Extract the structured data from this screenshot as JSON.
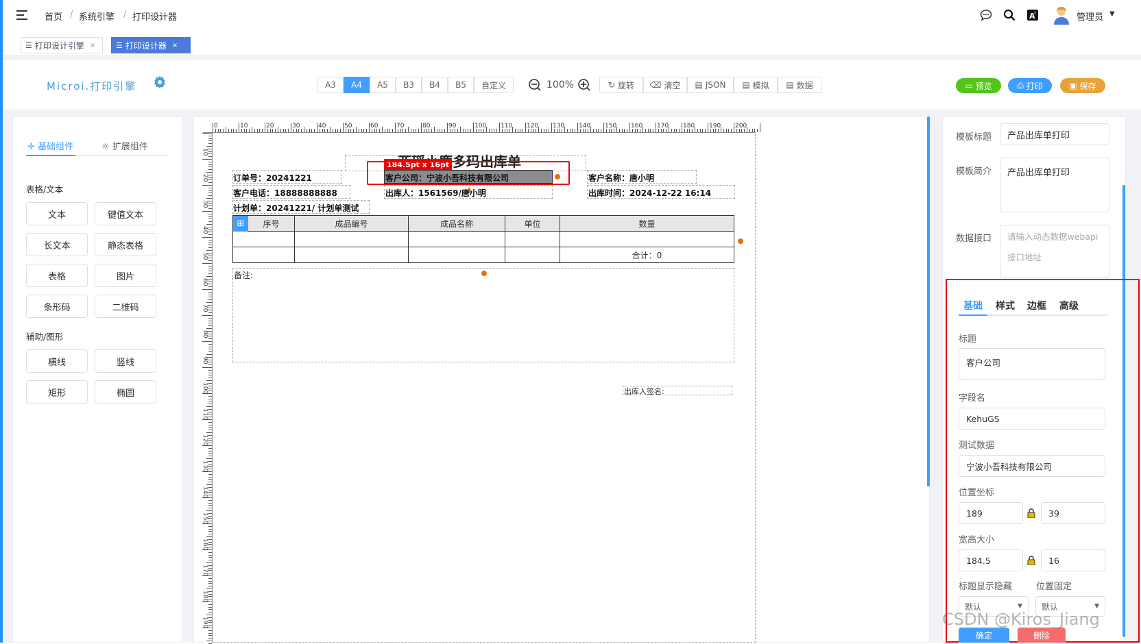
{
  "header": {
    "breadcrumb": [
      "首页",
      "系统引擎",
      "打印设计器"
    ],
    "user": "管理员"
  },
  "tabs": [
    {
      "label": "打印设计引擎",
      "active": false
    },
    {
      "label": "打印设计器",
      "active": true
    }
  ],
  "toolbar": {
    "logo": "Microi.打印引擎",
    "paper_sizes": [
      "A3",
      "A4",
      "A5",
      "B3",
      "B4",
      "B5",
      "自定义"
    ],
    "active_paper": "A4",
    "zoom": "100%",
    "actions": [
      "旋转",
      "清空",
      "JSON",
      "模拟",
      "数据"
    ],
    "preview": "预览",
    "print": "打印",
    "save": "保存"
  },
  "left_panel": {
    "tabs": [
      "基础组件",
      "扩展组件"
    ],
    "section1": "表格/文本",
    "section1_items": [
      "文本",
      "键值文本",
      "长文本",
      "静态表格",
      "表格",
      "图片",
      "条形码",
      "二维码"
    ],
    "section2": "辅助/图形",
    "section2_items": [
      "横线",
      "竖线",
      "矩形",
      "椭圆"
    ]
  },
  "canvas": {
    "ruler_top": [
      "0",
      "10",
      "20",
      "30",
      "40",
      "50",
      "60",
      "70",
      "80",
      "90",
      "100",
      "110",
      "120",
      "130",
      "140",
      "150",
      "160",
      "170",
      "180",
      "190",
      "200"
    ],
    "ruler_left": [
      "10",
      "20",
      "30",
      "40",
      "50",
      "60",
      "70",
      "80",
      "90",
      "100",
      "110",
      "120",
      "130",
      "140",
      "150",
      "160",
      "170",
      "180",
      "190"
    ],
    "title": "亚瑶小鹿多玛出库单",
    "size_badge": "184.5pt x 16pt",
    "order_no": "订单号：20241221",
    "customer_company": "客户公司：宁波小吾科技有限公司",
    "customer_name": "客户名称：唐小明",
    "customer_phone": "客户电话：18888888888",
    "outbound_person": "出库人：1561569/唐小明",
    "outbound_time": "出库时间：2024-12-22 16:14",
    "plan": "计划单：20241221/ 计划单测试",
    "table_headers": [
      "序号",
      "成品编号",
      "成品名称",
      "单位",
      "数量"
    ],
    "total": "合计：0",
    "remark": "备注:",
    "signature": "出库人签名:"
  },
  "right_panel": {
    "template_title_label": "模板标题",
    "template_title_value": "产品出库单打印",
    "template_desc_label": "模板简介",
    "template_desc_value": "产品出库单打印",
    "data_api_label": "数据接口",
    "data_api_placeholder": "请输入动态数据webapi接口地址",
    "prop_tabs": [
      "基础",
      "样式",
      "边框",
      "高级"
    ],
    "title_label": "标题",
    "title_value": "客户公司",
    "field_label": "字段名",
    "field_value": "KehuGS",
    "test_label": "测试数据",
    "test_value": "宁波小吾科技有限公司",
    "pos_label": "位置坐标",
    "pos_x": "189",
    "pos_y": "39",
    "size_label": "宽高大小",
    "width": "184.5",
    "height": "16",
    "title_vis_label": "标题显示隐藏",
    "pos_fixed_label": "位置固定",
    "title_vis_value": "默认",
    "pos_fixed_value": "默认",
    "confirm": "确定",
    "delete": "删除"
  },
  "watermark": "CSDN @Kiros_Jiang"
}
